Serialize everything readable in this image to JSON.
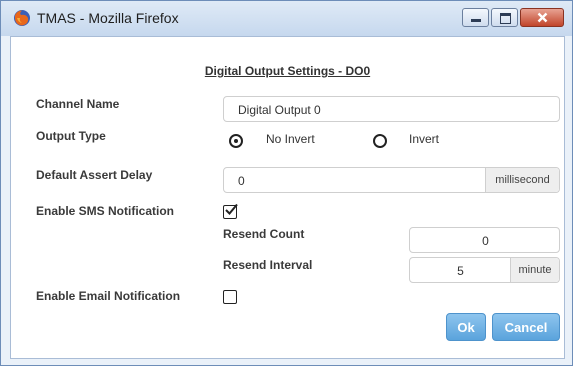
{
  "window": {
    "title": "TMAS - Mozilla Firefox"
  },
  "dialog": {
    "heading": "Digital Output Settings - DO0",
    "channel_name": {
      "label": "Channel Name",
      "value": "Digital Output 0"
    },
    "output_type": {
      "label": "Output Type",
      "options": [
        {
          "label": "No Invert",
          "selected": true
        },
        {
          "label": "Invert",
          "selected": false
        }
      ]
    },
    "default_assert_delay": {
      "label": "Default Assert Delay",
      "value": "0",
      "unit": "millisecond"
    },
    "sms": {
      "label": "Enable SMS Notification",
      "checked": true,
      "resend_count": {
        "label": "Resend Count",
        "value": "0"
      },
      "resend_interval": {
        "label": "Resend Interval",
        "value": "5",
        "unit": "minute"
      }
    },
    "email": {
      "label": "Enable Email Notification",
      "checked": false
    },
    "buttons": {
      "ok": "Ok",
      "cancel": "Cancel"
    }
  }
}
